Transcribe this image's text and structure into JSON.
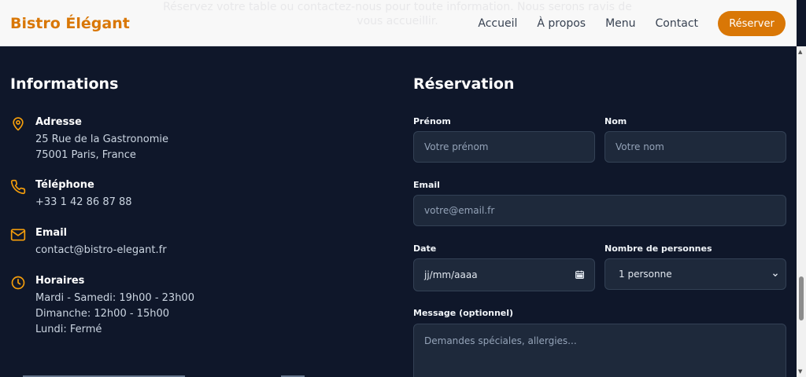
{
  "nav": {
    "brand": "Bistro Élégant",
    "links": [
      "Accueil",
      "À propos",
      "Menu",
      "Contact"
    ],
    "cta": "Réserver",
    "ghost_text": "Réservez votre table ou contactez-nous pour toute information. Nous serons ravis de vous accueillir."
  },
  "info": {
    "heading": "Informations",
    "address": {
      "title": "Adresse",
      "lines": [
        "25 Rue de la Gastronomie",
        "75001 Paris, France"
      ]
    },
    "phone": {
      "title": "Téléphone",
      "lines": [
        "+33 1 42 86 87 88"
      ]
    },
    "email": {
      "title": "Email",
      "lines": [
        "contact@bistro-elegant.fr"
      ]
    },
    "hours": {
      "title": "Horaires",
      "lines": [
        "Mardi - Samedi: 19h00 - 23h00",
        "Dimanche: 12h00 - 15h00",
        "Lundi: Fermé"
      ]
    }
  },
  "form": {
    "heading": "Réservation",
    "firstname": {
      "label": "Prénom",
      "placeholder": "Votre prénom"
    },
    "lastname": {
      "label": "Nom",
      "placeholder": "Votre nom"
    },
    "email": {
      "label": "Email",
      "placeholder": "votre@email.fr"
    },
    "date": {
      "label": "Date",
      "placeholder": "jj/mm/aaaa"
    },
    "guests": {
      "label": "Nombre de personnes",
      "value": "1 personne"
    },
    "message": {
      "label": "Message (optionnel)",
      "placeholder": "Demandes spéciales, allergies..."
    }
  },
  "colors": {
    "accent": "#d97706",
    "background": "#0f172a",
    "field": "#1e293b"
  },
  "icons": [
    "map-pin-icon",
    "phone-icon",
    "mail-icon",
    "clock-icon",
    "calendar-icon",
    "chevron-down-icon"
  ]
}
